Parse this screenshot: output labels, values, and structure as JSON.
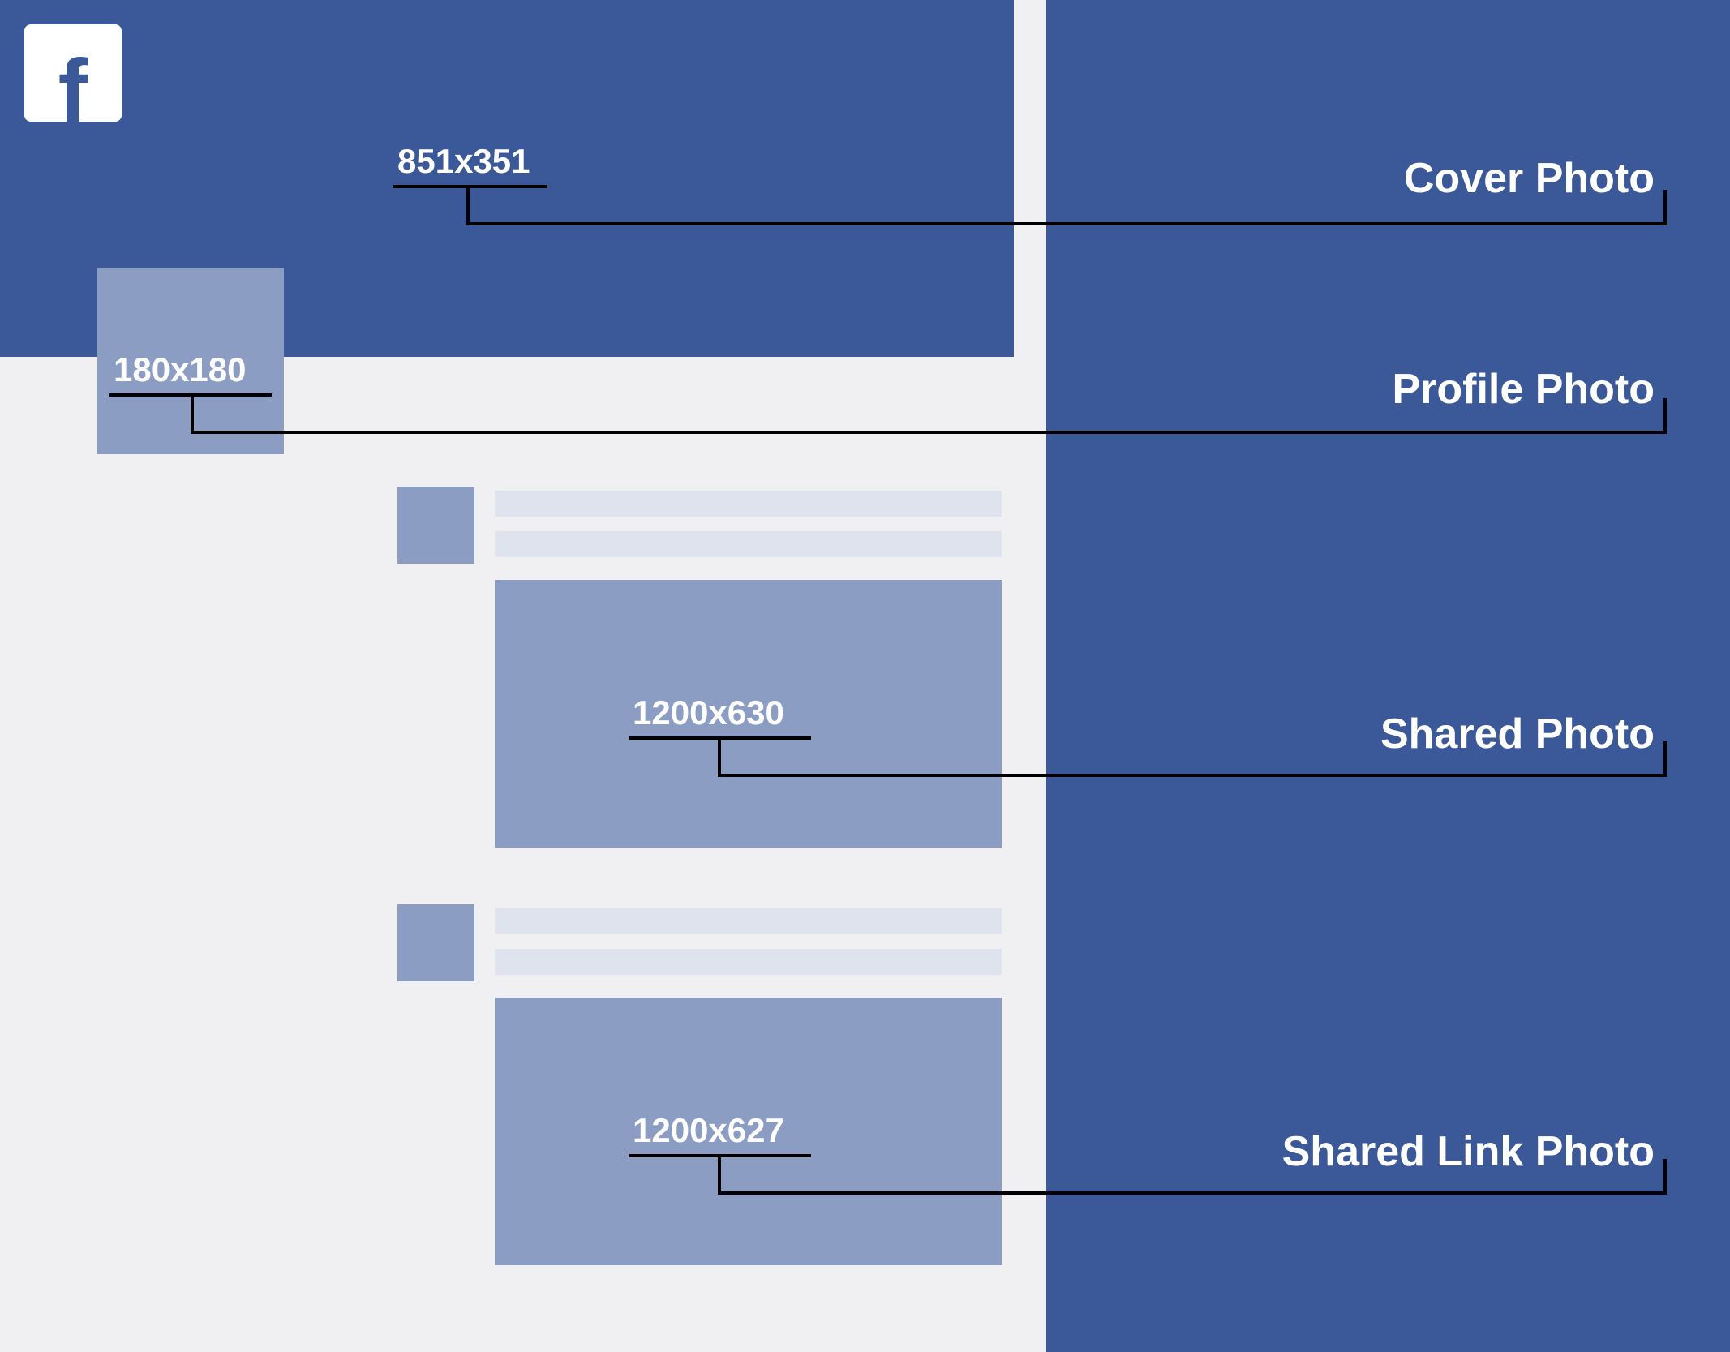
{
  "brand": {
    "letter": "f"
  },
  "cover": {
    "dim": "851x351",
    "label": "Cover Photo"
  },
  "profile": {
    "dim": "180x180",
    "label": "Profile Photo"
  },
  "sharedPhoto": {
    "dim": "1200x630",
    "label": "Shared Photo"
  },
  "sharedLink": {
    "dim": "1200x627",
    "label": "Shared Link Photo"
  }
}
